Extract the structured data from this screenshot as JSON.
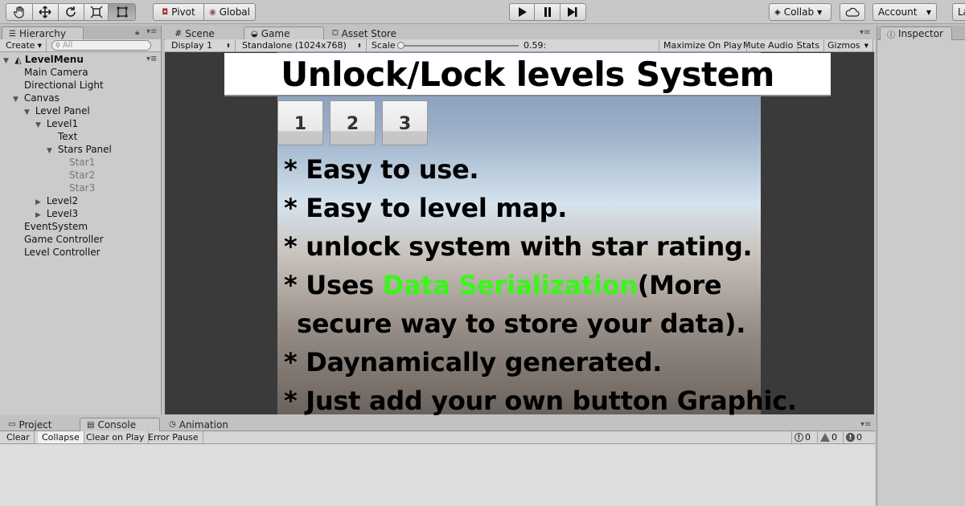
{
  "toolbar": {
    "pivot_label": "Pivot",
    "global_label": "Global",
    "collab_label": "Collab",
    "account_label": "Account",
    "layers_label": "La"
  },
  "hierarchy": {
    "tab_label": "Hierarchy",
    "create_label": "Create",
    "search_placeholder": "All",
    "scene_name": "LevelMenu",
    "items": [
      {
        "label": "Main Camera"
      },
      {
        "label": "Directional Light"
      },
      {
        "label": "Canvas"
      },
      {
        "label": "Level Panel"
      },
      {
        "label": "Level1"
      },
      {
        "label": "Text"
      },
      {
        "label": "Stars Panel"
      },
      {
        "label": "Star1"
      },
      {
        "label": "Star2"
      },
      {
        "label": "Star3"
      },
      {
        "label": "Level2"
      },
      {
        "label": "Level3"
      },
      {
        "label": "EventSystem"
      },
      {
        "label": "Game Controller"
      },
      {
        "label": "Level Controller"
      }
    ]
  },
  "center_tabs": {
    "scene": "Scene",
    "game": "Game",
    "asset_store": "Asset Store"
  },
  "game_toolbar": {
    "display": "Display 1",
    "resolution": "Standalone (1024x768)",
    "scale_label": "Scale",
    "scale_value": "0.59:",
    "maximize": "Maximize On Play",
    "mute": "Mute Audio",
    "stats": "Stats",
    "gizmos": "Gizmos"
  },
  "game_view": {
    "title": "Unlock/Lock levels System",
    "level_buttons": [
      "1",
      "2",
      "3"
    ],
    "features": [
      "* Easy to use.",
      "* Easy to level map.",
      "* unlock system with star rating.",
      "* Uses ",
      "Data Serialization",
      "(More",
      "secure way to store your data).",
      "* Daynamically generated.",
      "* Just add your own button Graphic."
    ],
    "highlight_color": "#3cf51a"
  },
  "bottom_tabs": {
    "project": "Project",
    "console": "Console",
    "animation": "Animation"
  },
  "console_toolbar": {
    "clear": "Clear",
    "collapse": "Collapse",
    "clear_on_play": "Clear on Play",
    "error_pause": "Error Pause",
    "info_count": "0",
    "warning_count": "0",
    "error_count": "0"
  },
  "inspector": {
    "tab_label": "Inspector"
  }
}
